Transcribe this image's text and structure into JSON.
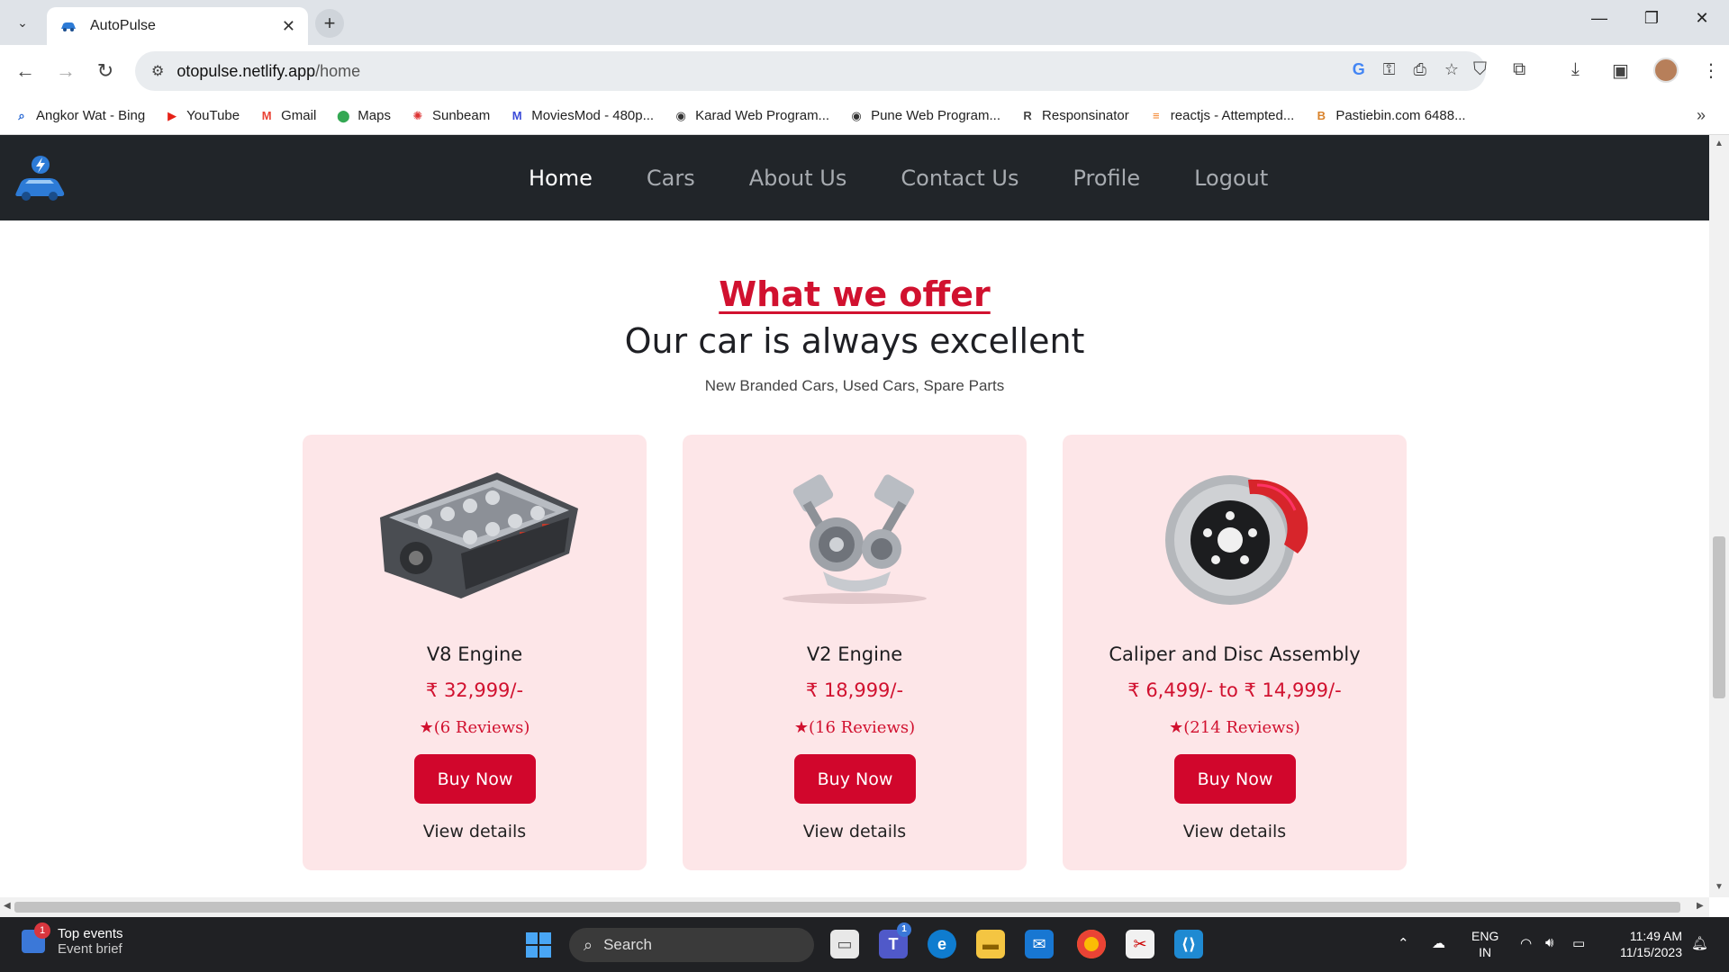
{
  "browser": {
    "tab_title": "AutoPulse",
    "url_host": "otopulse.netlify.app",
    "url_path": "/home",
    "bookmarks": [
      {
        "label": "Angkor Wat - Bing",
        "icon": "bing-search-icon",
        "color": "#1a5fd1"
      },
      {
        "label": "YouTube",
        "icon": "youtube-icon",
        "color": "#e62117"
      },
      {
        "label": "Gmail",
        "icon": "gmail-icon",
        "color": "#ea4335"
      },
      {
        "label": "Maps",
        "icon": "maps-pin-icon",
        "color": "#34a853"
      },
      {
        "label": "Sunbeam",
        "icon": "sunbeam-icon",
        "color": "#d33"
      },
      {
        "label": "MoviesMod - 480p...",
        "icon": "moviesmod-icon",
        "color": "#3b4bd8"
      },
      {
        "label": "Karad Web Program...",
        "icon": "globe-icon",
        "color": "#333"
      },
      {
        "label": "Pune Web Program...",
        "icon": "globe-icon",
        "color": "#333"
      },
      {
        "label": "Responsinator",
        "icon": "responsinator-icon",
        "color": "#444"
      },
      {
        "label": "reactjs - Attempted...",
        "icon": "stackoverflow-icon",
        "color": "#f48024"
      },
      {
        "label": "Pastiebin.com 6488...",
        "icon": "pastebin-icon",
        "color": "#d9822b"
      }
    ]
  },
  "site": {
    "nav": [
      {
        "label": "Home",
        "active": true
      },
      {
        "label": "Cars",
        "active": false
      },
      {
        "label": "About Us",
        "active": false
      },
      {
        "label": "Contact Us",
        "active": false
      },
      {
        "label": "Profile",
        "active": false
      },
      {
        "label": "Logout",
        "active": false
      }
    ],
    "section_title": "What we offer",
    "headline": "Our car is always excellent",
    "subline": "New Branded Cars, Used Cars, Spare Parts",
    "products": [
      {
        "name": "V8 Engine",
        "price": "₹ 32,999/-",
        "reviews": "(6  Reviews)",
        "buy_label": "Buy Now",
        "details_label": "View details",
        "image": "v8-engine-image"
      },
      {
        "name": "V2 Engine",
        "price": "₹ 18,999/-",
        "reviews": "(16  Reviews)",
        "buy_label": "Buy Now",
        "details_label": "View details",
        "image": "v2-engine-image"
      },
      {
        "name": "Caliper and Disc Assembly",
        "price": "₹ 6,499/- to ₹ 14,999/-",
        "reviews": "(214  Reviews)",
        "buy_label": "Buy Now",
        "details_label": "View details",
        "image": "brake-caliper-disc-image"
      }
    ],
    "colors": {
      "accent": "#d1112f",
      "card_bg": "#fde6e8",
      "nav_bg": "#212529"
    }
  },
  "taskbar": {
    "widget_title": "Top events",
    "widget_subtitle": "Event brief",
    "widget_badge": "1",
    "search_label": "Search",
    "teams_badge": "1",
    "lang_line1": "ENG",
    "lang_line2": "IN",
    "time": "11:49 AM",
    "date": "11/15/2023"
  }
}
